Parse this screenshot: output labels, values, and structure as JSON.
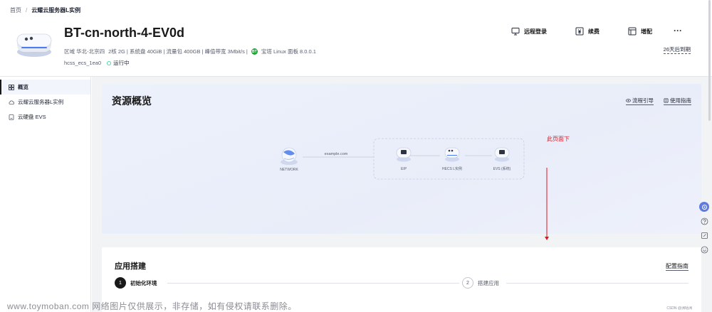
{
  "breadcrumb": {
    "home": "首页",
    "separator": "/",
    "current": "云耀云服务器L实例"
  },
  "header": {
    "title": "BT-cn-north-4-EV0d",
    "region": "区域 华北-北京四",
    "specs": "2核 2G | 系统盘 40GiB | 流量包 400GB | 峰值带宽 3Mbit/s |",
    "panel_badge": "BT",
    "panel": "宝塔 Linux 面板 8.0.0.1",
    "instance_id": "hcss_ecs_1ea0",
    "status": "运行中",
    "expiry": "26天后到期"
  },
  "actions": {
    "remote_login": "远程登录",
    "renew": "续费",
    "upgrade": "增配",
    "more": "···"
  },
  "sidebar": {
    "items": [
      {
        "label": "概览",
        "icon": "grid-icon"
      },
      {
        "label": "云耀云服务器L实例",
        "icon": "cloud-icon"
      },
      {
        "label": "云硬盘 EVS",
        "icon": "disk-icon"
      }
    ]
  },
  "overview": {
    "title": "资源概览",
    "flow_guide": "流程引导",
    "usage_guide": "使用指南",
    "topology": {
      "network": "NETWORK",
      "domain": "example.com",
      "eip": "EIP",
      "hecs": "HECS L实例",
      "evs": "EVS (系统)"
    },
    "annotation": "此页面下"
  },
  "app_setup": {
    "title": "应用搭建",
    "config_guide": "配置指南",
    "steps": [
      {
        "num": "1",
        "label": "初始化环境"
      },
      {
        "num": "2",
        "label": "搭建应用"
      }
    ]
  },
  "watermark": {
    "text": "www.toymoban.com 网络图片仅供展示，非存储，如有侵权请联系删除。",
    "small": "CSDN @洲咕洲"
  },
  "colors": {
    "status_ok": "#50d4ab",
    "annotation": "#e5141b",
    "accent": "#5e7ce0",
    "bt_green": "#20a53a"
  }
}
